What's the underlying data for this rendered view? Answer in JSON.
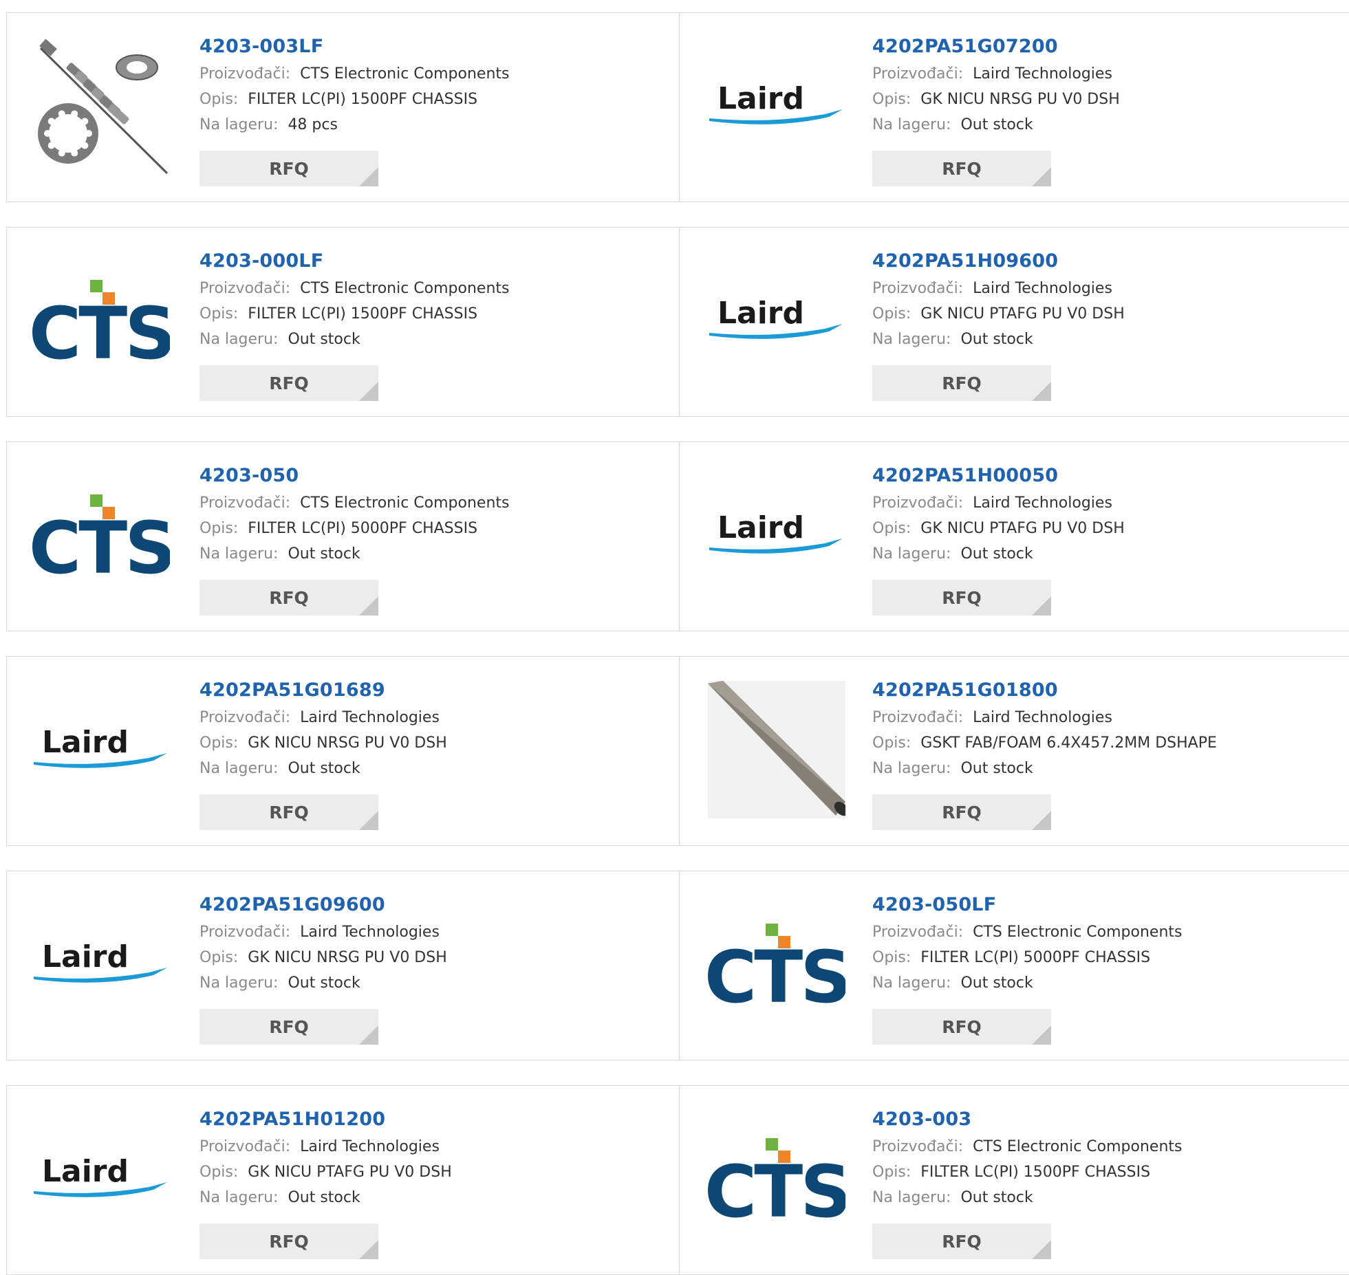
{
  "labels": {
    "manufacturer": "Proizvođači:",
    "description": "Opis:",
    "stock": "Na lageru:",
    "rfq": "RFQ"
  },
  "logos": {
    "cts": "CTS",
    "laird": "Laird"
  },
  "colors": {
    "part_link": "#1f62ad",
    "cts_navy": "#0d4774",
    "cts_teal": "#0f7d8b",
    "cts_green": "#6cb33f",
    "cts_orange": "#f0842a",
    "laird_text": "#1a1a1a",
    "laird_swoosh": "#1a9ad6",
    "rfq_bg": "#ececec"
  },
  "products": [
    {
      "part": "4203-003LF",
      "manufacturer": "CTS Electronic Components",
      "description": "FILTER LC(PI) 1500PF CHASSIS",
      "stock": "48 pcs",
      "image": "filter-photo"
    },
    {
      "part": "4202PA51G07200",
      "manufacturer": "Laird Technologies",
      "description": "GK NICU NRSG PU V0 DSH",
      "stock": "Out stock",
      "image": "laird-logo"
    },
    {
      "part": "4203-000LF",
      "manufacturer": "CTS Electronic Components",
      "description": "FILTER LC(PI) 1500PF CHASSIS",
      "stock": "Out stock",
      "image": "cts-logo"
    },
    {
      "part": "4202PA51H09600",
      "manufacturer": "Laird Technologies",
      "description": "GK NICU PTAFG PU V0 DSH",
      "stock": "Out stock",
      "image": "laird-logo"
    },
    {
      "part": "4203-050",
      "manufacturer": "CTS Electronic Components",
      "description": "FILTER LC(PI) 5000PF CHASSIS",
      "stock": "Out stock",
      "image": "cts-logo"
    },
    {
      "part": "4202PA51H00050",
      "manufacturer": "Laird Technologies",
      "description": "GK NICU PTAFG PU V0 DSH",
      "stock": "Out stock",
      "image": "laird-logo"
    },
    {
      "part": "4202PA51G01689",
      "manufacturer": "Laird Technologies",
      "description": "GK NICU NRSG PU V0 DSH",
      "stock": "Out stock",
      "image": "laird-logo"
    },
    {
      "part": "4202PA51G01800",
      "manufacturer": "Laird Technologies",
      "description": "GSKT FAB/FOAM 6.4X457.2MM DSHAPE",
      "stock": "Out stock",
      "image": "gasket-photo"
    },
    {
      "part": "4202PA51G09600",
      "manufacturer": "Laird Technologies",
      "description": "GK NICU NRSG PU V0 DSH",
      "stock": "Out stock",
      "image": "laird-logo"
    },
    {
      "part": "4203-050LF",
      "manufacturer": "CTS Electronic Components",
      "description": "FILTER LC(PI) 5000PF CHASSIS",
      "stock": "Out stock",
      "image": "cts-logo"
    },
    {
      "part": "4202PA51H01200",
      "manufacturer": "Laird Technologies",
      "description": "GK NICU PTAFG PU V0 DSH",
      "stock": "Out stock",
      "image": "laird-logo"
    },
    {
      "part": "4203-003",
      "manufacturer": "CTS Electronic Components",
      "description": "FILTER LC(PI) 1500PF CHASSIS",
      "stock": "Out stock",
      "image": "cts-logo"
    }
  ]
}
